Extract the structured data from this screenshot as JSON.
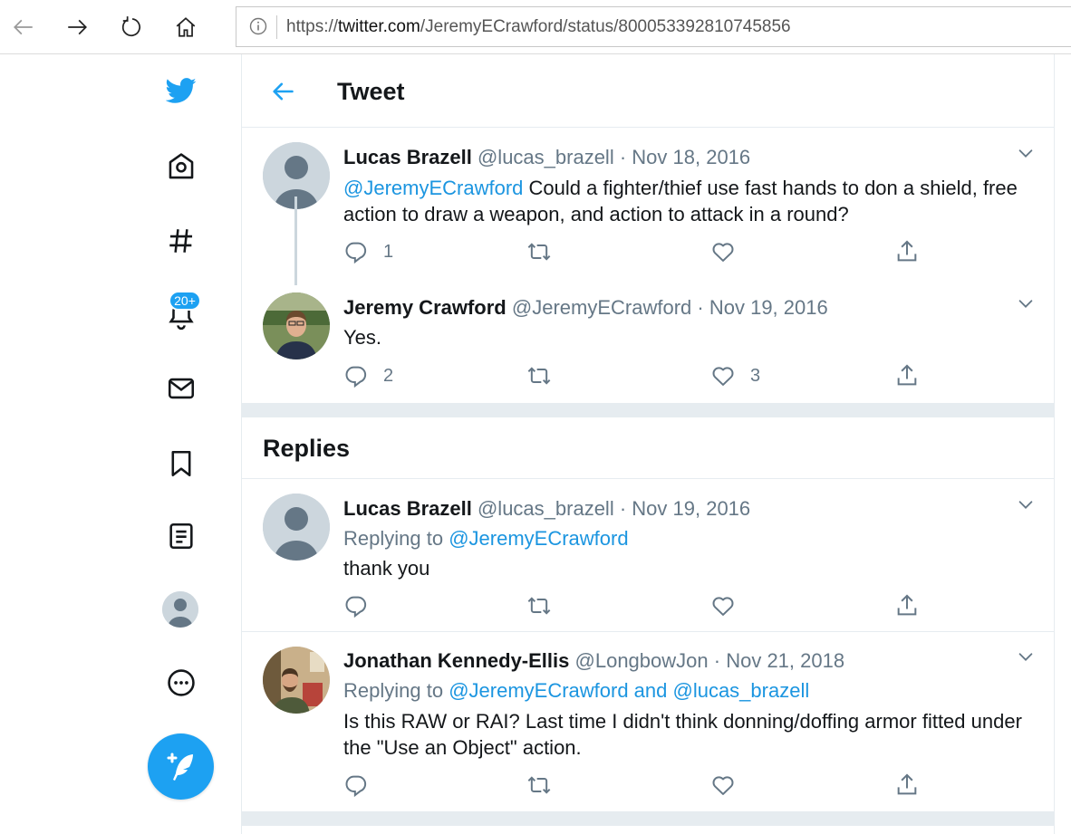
{
  "browser": {
    "url_prefix": "https://",
    "url_host": "twitter.com",
    "url_path": "/JeremyECrawford/status/800053392810745856",
    "icons": [
      "back-arrow-icon",
      "forward-arrow-icon",
      "refresh-icon",
      "home-icon",
      "info-icon"
    ]
  },
  "sidebar": {
    "notification_badge": "20+",
    "icons": [
      "twitter-bird-icon",
      "home-icon",
      "hashtag-icon",
      "bell-icon",
      "mail-icon",
      "bookmark-icon",
      "list-icon",
      "profile-avatar",
      "more-icon",
      "compose-tweet-icon"
    ]
  },
  "header": {
    "title": "Tweet"
  },
  "thread": [
    {
      "name": "Lucas Brazell",
      "handle": "@lucas_brazell",
      "dot": "·",
      "date": "Nov 18, 2016",
      "mention": "@JeremyECrawford",
      "text": " Could a fighter/thief use fast hands to don a shield, free action to draw a weapon, and action to attack in a round?",
      "reply_count": "1",
      "retweet_count": "",
      "like_count": ""
    },
    {
      "name": "Jeremy Crawford",
      "handle": "@JeremyECrawford",
      "dot": "·",
      "date": "Nov 19, 2016",
      "text": "Yes.",
      "reply_count": "2",
      "retweet_count": "",
      "like_count": "3"
    }
  ],
  "replies_title": "Replies",
  "replies": [
    {
      "name": "Lucas Brazell",
      "handle": "@lucas_brazell",
      "dot": "·",
      "date": "Nov 19, 2016",
      "replying_label": "Replying to ",
      "replying_to": "@JeremyECrawford",
      "text": "thank you"
    },
    {
      "name": "Jonathan Kennedy-Ellis",
      "handle": "@LongbowJon",
      "dot": "·",
      "date": "Nov 21, 2018",
      "replying_label": "Replying to ",
      "replying_to": "@JeremyECrawford and @lucas_brazell",
      "text": "Is this RAW or RAI? Last time I didn't think donning/doffing armor fitted under the \"Use an Object\" action."
    }
  ],
  "colors": {
    "accent": "#1da1f2",
    "link": "#1b95e0",
    "secondary_text": "#657786",
    "border": "#e6ecf0"
  }
}
